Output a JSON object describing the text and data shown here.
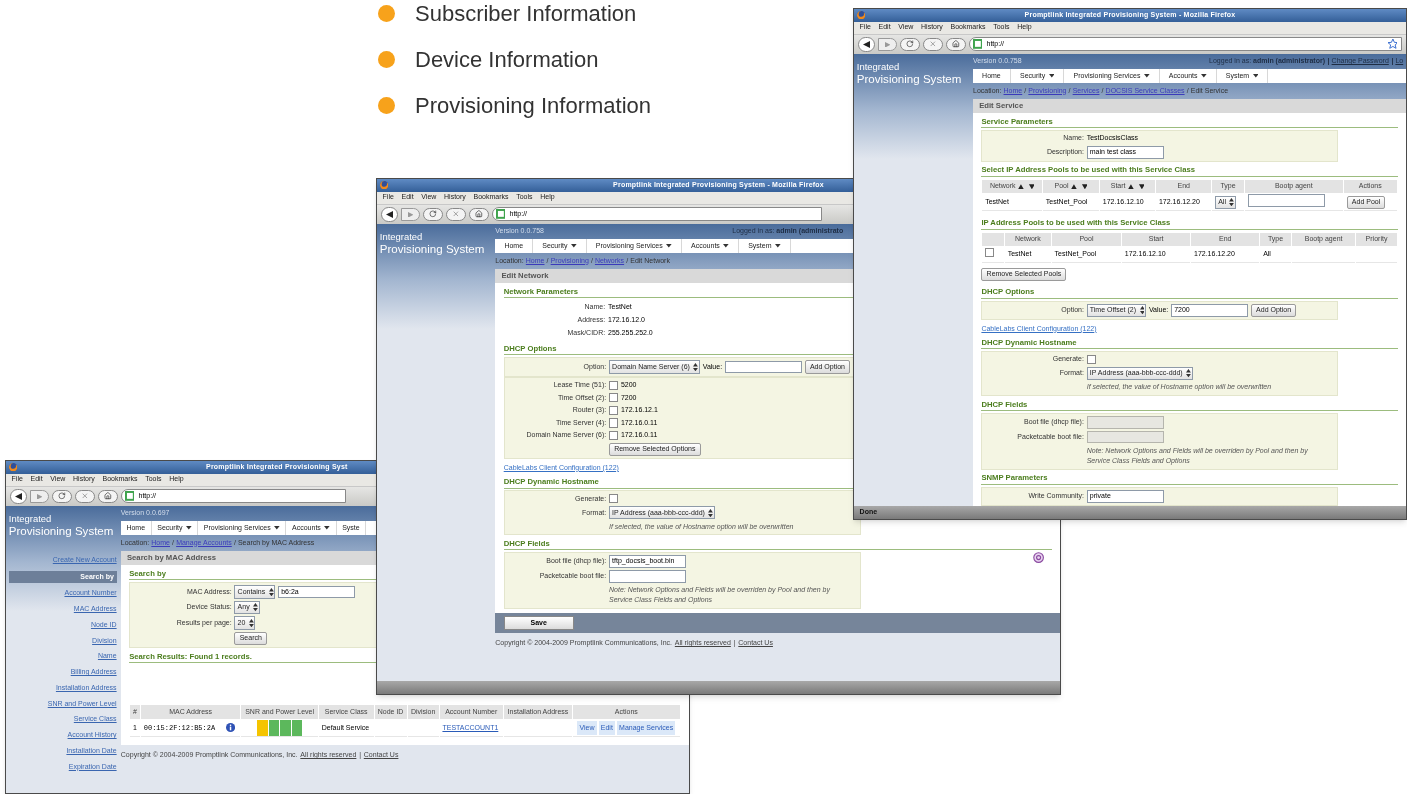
{
  "bullets": [
    {
      "text": "Subscriber Information"
    },
    {
      "text": "Device Information"
    },
    {
      "text": "Provisioning Information"
    }
  ],
  "windows": [
    {
      "kind": "search",
      "title": "Promptlink Integrated Provisioning Syst",
      "menu": [
        "File",
        "Edit",
        "View",
        "History",
        "Bookmarks",
        "Tools",
        "Help"
      ],
      "url": "http://",
      "bookmark_star": false,
      "brand": [
        "Integrated",
        "Provisioning System"
      ],
      "version": "Version 0.0.697",
      "nav": [
        {
          "label": "Home",
          "dropdown": false
        },
        {
          "label": "Security",
          "dropdown": true
        },
        {
          "label": "Provisioning Services",
          "dropdown": true
        },
        {
          "label": "Accounts",
          "dropdown": true
        },
        {
          "label": "Syste",
          "dropdown": false
        }
      ],
      "location": {
        "label": "Location:",
        "separator": "/",
        "items": [
          {
            "text": "Home",
            "link": true
          },
          {
            "text": "Manage Accounts",
            "link": true
          },
          {
            "text": "Search by MAC Address",
            "link": false
          }
        ]
      },
      "sidebar": [
        {
          "text": "Create New Account",
          "kind": "link"
        },
        {
          "text": "Search by",
          "kind": "header"
        },
        {
          "text": "Account Number",
          "kind": "link"
        },
        {
          "text": "MAC Address",
          "kind": "link"
        },
        {
          "text": "Node ID",
          "kind": "link"
        },
        {
          "text": "Division",
          "kind": "link"
        },
        {
          "text": "Name",
          "kind": "link"
        },
        {
          "text": "Billing Address",
          "kind": "link"
        },
        {
          "text": "Installation Address",
          "kind": "link"
        },
        {
          "text": "SNR and Power Level",
          "kind": "link"
        },
        {
          "text": "Service Class",
          "kind": "link"
        },
        {
          "text": "Account History",
          "kind": "link"
        },
        {
          "text": "Installation Date",
          "kind": "link"
        },
        {
          "text": "Expiration Date",
          "kind": "link"
        }
      ],
      "panel_title": "Search by MAC Address",
      "sections": [
        {
          "kind": "heading",
          "text": "Search by"
        },
        {
          "kind": "form",
          "boxed": true,
          "rows": [
            {
              "label": "MAC Address:",
              "controls": [
                {
                  "kind": "select",
                  "value": "Contains"
                },
                {
                  "kind": "input",
                  "value": "b6:2a"
                }
              ]
            },
            {
              "label": "Device Status:",
              "controls": [
                {
                  "kind": "select",
                  "value": "Any"
                }
              ]
            },
            {
              "label": "Results per page:",
              "controls": [
                {
                  "kind": "select",
                  "value": "20"
                }
              ]
            },
            {
              "controls": [
                {
                  "kind": "button",
                  "value": "Search"
                }
              ]
            }
          ]
        },
        {
          "kind": "heading",
          "text": "Search Results: Found 1 records."
        },
        {
          "kind": "table",
          "columns": [
            {
              "label": "#",
              "sort": false
            },
            {
              "label": "MAC Address",
              "sort": false
            },
            {
              "label": "SNR and Power Level",
              "sort": false
            },
            {
              "label": "Service Class",
              "sort": false
            },
            {
              "label": "Node ID",
              "sort": false
            },
            {
              "label": "Division",
              "sort": false
            },
            {
              "label": "Account Number",
              "sort": false
            },
            {
              "label": "Installation Address",
              "sort": false
            },
            {
              "label": "Actions",
              "sort": false
            }
          ],
          "rows": [
            [
              {
                "kind": "text",
                "value": "1"
              },
              {
                "kind": "mac",
                "value": "00:15:2F:12:B5:2A"
              },
              {
                "kind": "signal",
                "bars": [
                  {
                    "color": "#f5c400"
                  },
                  {
                    "color": "#5cb85c"
                  },
                  {
                    "color": "#5cb85c"
                  },
                  {
                    "color": "#5cb85c"
                  }
                ]
              },
              {
                "kind": "text",
                "value": "Default Service"
              },
              {
                "kind": "empty"
              },
              {
                "kind": "empty"
              },
              {
                "kind": "link",
                "value": "TESTACCOUNT1"
              },
              {
                "kind": "empty"
              },
              {
                "kind": "actions",
                "items": [
                  "View",
                  "Edit",
                  "Manage Services"
                ]
              }
            ]
          ]
        }
      ],
      "copyright": {
        "text": "Copyright © 2004-2009 Promptlink Communications, Inc.",
        "links": [
          "All rights reserved",
          "Contact Us"
        ],
        "separator": "|"
      },
      "status_bar": false
    },
    {
      "kind": "network",
      "title": "Promptlink Integrated Provisioning System - Mozilla Firefox",
      "menu": [
        "File",
        "Edit",
        "View",
        "History",
        "Bookmarks",
        "Tools",
        "Help"
      ],
      "url": "http://",
      "bookmark_star": false,
      "brand": [
        "Integrated",
        "Provisioning System"
      ],
      "version": "Version 0.0.758",
      "logged_in": "Logged in as: **admin (administrato**",
      "nav": [
        {
          "label": "Home",
          "dropdown": false
        },
        {
          "label": "Security",
          "dropdown": true
        },
        {
          "label": "Provisioning Services",
          "dropdown": true
        },
        {
          "label": "Accounts",
          "dropdown": true
        },
        {
          "label": "System",
          "dropdown": true
        }
      ],
      "location": {
        "label": "Location:",
        "separator": "/",
        "items": [
          {
            "text": "Home",
            "link": true
          },
          {
            "text": "Provisioning",
            "link": true
          },
          {
            "text": "Networks",
            "link": true
          },
          {
            "text": "Edit Network",
            "link": false
          }
        ]
      },
      "panel_title": "Edit Network",
      "sections": [
        {
          "kind": "heading",
          "text": "Network Parameters"
        },
        {
          "kind": "form",
          "boxed": false,
          "rows": [
            {
              "label": "Name:",
              "controls": [
                {
                  "kind": "text",
                  "value": "TestNet"
                }
              ]
            },
            {
              "label": "Address:",
              "controls": [
                {
                  "kind": "text",
                  "value": "172.16.12.0"
                }
              ]
            },
            {
              "label": "Mask/CIDR:",
              "controls": [
                {
                  "kind": "text",
                  "value": "255.255.252.0"
                }
              ]
            }
          ]
        },
        {
          "kind": "heading",
          "text": "DHCP Options"
        },
        {
          "kind": "form",
          "boxed": true,
          "rows": [
            {
              "label": "Option:",
              "controls": [
                {
                  "kind": "select",
                  "value": "Domain Name Server (6)"
                },
                {
                  "kind": "label",
                  "value": "Value:"
                },
                {
                  "kind": "input"
                },
                {
                  "kind": "button",
                  "value": "Add Option"
                }
              ]
            }
          ]
        },
        {
          "kind": "form",
          "boxed": true,
          "rows": [
            {
              "label": "Lease Time (51):",
              "controls": [
                {
                  "kind": "checkbox",
                  "checked": false
                },
                {
                  "kind": "text",
                  "value": "5200"
                }
              ]
            },
            {
              "label": "Time Offset (2):",
              "controls": [
                {
                  "kind": "checkbox",
                  "checked": false
                },
                {
                  "kind": "text",
                  "value": "7200"
                }
              ]
            },
            {
              "label": "Router (3):",
              "controls": [
                {
                  "kind": "checkbox",
                  "checked": false
                },
                {
                  "kind": "text",
                  "value": "172.16.12.1"
                }
              ]
            },
            {
              "label": "Time Server (4):",
              "controls": [
                {
                  "kind": "checkbox",
                  "checked": false
                },
                {
                  "kind": "text",
                  "value": "172.16.0.11"
                }
              ]
            },
            {
              "label": "Domain Name Server (6):",
              "controls": [
                {
                  "kind": "checkbox",
                  "checked": false
                },
                {
                  "kind": "text",
                  "value": "172.16.0.11"
                }
              ]
            },
            {
              "controls": [
                {
                  "kind": "button",
                  "value": "Remove Selected Options"
                }
              ]
            }
          ]
        },
        {
          "kind": "link",
          "text": "CableLabs Client Configuration (122)"
        },
        {
          "kind": "heading",
          "text": "DHCP Dynamic Hostname"
        },
        {
          "kind": "form",
          "boxed": true,
          "rows": [
            {
              "label": "Generate:",
              "controls": [
                {
                  "kind": "checkbox",
                  "checked": false
                }
              ]
            },
            {
              "label": "Format:",
              "controls": [
                {
                  "kind": "select",
                  "value": "IP Address (aaa-bbb-ccc-ddd)"
                }
              ]
            }
          ],
          "note": "If selected, the value of Hostname option will be overwritten"
        },
        {
          "kind": "heading",
          "text": "DHCP Fields"
        },
        {
          "kind": "form",
          "boxed": true,
          "corner_icon": true,
          "rows": [
            {
              "label": "Boot file (dhcp file):",
              "controls": [
                {
                  "kind": "input",
                  "value": "tftp_docsis_boot.bin"
                }
              ]
            },
            {
              "label": "Packetcable boot file:",
              "controls": [
                {
                  "kind": "input"
                }
              ]
            }
          ],
          "note": "Note: Network Options and Fields will be overriden by Pool and then by Service Class Fields and Options"
        }
      ],
      "save": "Save",
      "copyright": {
        "text": "Copyright © 2004-2009 Promptlink Communications, Inc.",
        "links": [
          "All rights reserved",
          "Contact Us"
        ],
        "separator": "|"
      },
      "status_bar": true
    },
    {
      "kind": "service",
      "title": "Promptlink Integrated Provisioning System - Mozilla Firefox",
      "menu": [
        "File",
        "Edit",
        "View",
        "History",
        "Bookmarks",
        "Tools",
        "Help"
      ],
      "url": "http://",
      "bookmark_star": true,
      "brand": [
        "Integrated",
        "Provisioning System"
      ],
      "version": "Version 0.0.758",
      "logged_in": "Logged in as: **admin (administrator)**",
      "account_links": [
        "Change Password",
        "Lo"
      ],
      "nav": [
        {
          "label": "Home",
          "dropdown": false
        },
        {
          "label": "Security",
          "dropdown": true
        },
        {
          "label": "Provisioning Services",
          "dropdown": true
        },
        {
          "label": "Accounts",
          "dropdown": true
        },
        {
          "label": "System",
          "dropdown": true
        }
      ],
      "location": {
        "label": "Location:",
        "separator": "/",
        "items": [
          {
            "text": "Home",
            "link": true
          },
          {
            "text": "Provisioning",
            "link": true
          },
          {
            "text": "Services",
            "link": true
          },
          {
            "text": "DOCSIS Service Classes",
            "link": true
          },
          {
            "text": "Edit Service",
            "link": false
          }
        ]
      },
      "panel_title": "Edit Service",
      "sections": [
        {
          "kind": "heading",
          "text": "Service Parameters"
        },
        {
          "kind": "form",
          "boxed": true,
          "rows": [
            {
              "label": "Name:",
              "controls": [
                {
                  "kind": "text",
                  "value": "TestDocsisClass"
                }
              ]
            },
            {
              "label": "Description:",
              "controls": [
                {
                  "kind": "input",
                  "value": "main test class"
                }
              ]
            }
          ]
        },
        {
          "kind": "heading",
          "text": "Select IP Address Pools to be used with this Service Class"
        },
        {
          "kind": "table",
          "columns": [
            {
              "label": "Network",
              "sort": true
            },
            {
              "label": "Pool",
              "sort": true
            },
            {
              "label": "Start",
              "sort": true
            },
            {
              "label": "End",
              "sort": false
            },
            {
              "label": "Type",
              "sort": false
            },
            {
              "label": "Bootp agent",
              "sort": false
            },
            {
              "label": "Actions",
              "sort": false
            }
          ],
          "rows": [
            [
              {
                "kind": "text",
                "value": "TestNet"
              },
              {
                "kind": "text",
                "value": "TestNet_Pool"
              },
              {
                "kind": "text",
                "value": "172.16.12.10"
              },
              {
                "kind": "text",
                "value": "172.16.12.20"
              },
              {
                "kind": "select",
                "value": "All"
              },
              {
                "kind": "input"
              },
              {
                "kind": "button",
                "value": "Add Pool"
              }
            ]
          ]
        },
        {
          "kind": "heading",
          "text": "IP Address Pools to be used with this Service Class"
        },
        {
          "kind": "table",
          "columns": [
            {
              "sort": false
            },
            {
              "label": "Network",
              "sort": false
            },
            {
              "label": "Pool",
              "sort": false
            },
            {
              "label": "Start",
              "sort": false
            },
            {
              "label": "End",
              "sort": false
            },
            {
              "label": "Type",
              "sort": false
            },
            {
              "label": "Bootp agent",
              "sort": false
            },
            {
              "label": "Priority",
              "sort": false
            }
          ],
          "rows": [
            [
              {
                "kind": "checkbox",
                "checked": false
              },
              {
                "kind": "text",
                "value": "TestNet"
              },
              {
                "kind": "text",
                "value": "TestNet_Pool"
              },
              {
                "kind": "text",
                "value": "172.16.12.10"
              },
              {
                "kind": "text",
                "value": "172.16.12.20"
              },
              {
                "kind": "text",
                "value": "All"
              },
              {
                "kind": "empty"
              },
              {
                "kind": "empty"
              }
            ]
          ]
        },
        {
          "kind": "button",
          "text": "Remove Selected Pools"
        },
        {
          "kind": "heading",
          "text": "DHCP Options"
        },
        {
          "kind": "form",
          "boxed": true,
          "rows": [
            {
              "label": "Option:",
              "controls": [
                {
                  "kind": "select",
                  "value": "Time Offset (2)"
                },
                {
                  "kind": "label",
                  "value": "Value:"
                },
                {
                  "kind": "input",
                  "value": "7200"
                },
                {
                  "kind": "button",
                  "value": "Add Option"
                }
              ]
            }
          ]
        },
        {
          "kind": "link",
          "text": "CableLabs Client Configuration (122)"
        },
        {
          "kind": "heading",
          "text": "DHCP Dynamic Hostname"
        },
        {
          "kind": "form",
          "boxed": true,
          "rows": [
            {
              "label": "Generate:",
              "controls": [
                {
                  "kind": "checkbox",
                  "checked": false
                }
              ]
            },
            {
              "label": "Format:",
              "controls": [
                {
                  "kind": "select",
                  "value": "IP Address (aaa-bbb-ccc-ddd)"
                }
              ]
            }
          ],
          "note": "If selected, the value of Hostname option will be overwritten"
        },
        {
          "kind": "heading",
          "text": "DHCP Fields"
        },
        {
          "kind": "form",
          "boxed": true,
          "rows": [
            {
              "label": "Boot file (dhcp file):",
              "controls": [
                {
                  "kind": "disabled_input"
                }
              ]
            },
            {
              "label": "Packetcable boot file:",
              "controls": [
                {
                  "kind": "disabled_input"
                }
              ]
            }
          ],
          "note": "Note: Network Options and Fields will be overriden by Pool and then by Service Class Fields and Options"
        },
        {
          "kind": "heading",
          "text": "SNMP Parameters"
        },
        {
          "kind": "form",
          "boxed": true,
          "rows": [
            {
              "label": "Write Community:",
              "controls": [
                {
                  "kind": "input",
                  "value": "private"
                }
              ]
            }
          ]
        }
      ],
      "status": "Done",
      "status_bar": true
    }
  ]
}
